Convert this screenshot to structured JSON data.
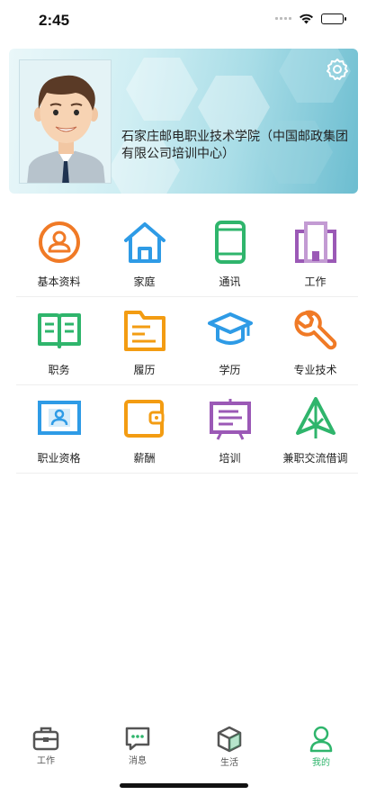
{
  "status_bar": {
    "time": "2:45"
  },
  "profile": {
    "organization": "石家庄邮电职业技术学院（中国邮政集团有限公司培训中心）",
    "accent": "#6cbdd0"
  },
  "grid": [
    {
      "label": "基本资料",
      "icon": "person-circle-icon",
      "color": "#f07a26"
    },
    {
      "label": "家庭",
      "icon": "house-icon",
      "color": "#2e9be6"
    },
    {
      "label": "通讯",
      "icon": "phone-icon",
      "color": "#2fb56c"
    },
    {
      "label": "工作",
      "icon": "building-icon",
      "color": "#9b59b6"
    },
    {
      "label": "职务",
      "icon": "book-icon",
      "color": "#2fb56c"
    },
    {
      "label": "履历",
      "icon": "folder-icon",
      "color": "#f39c12"
    },
    {
      "label": "学历",
      "icon": "graduation-cap-icon",
      "color": "#2e9be6"
    },
    {
      "label": "专业技术",
      "icon": "wrench-icon",
      "color": "#f07a26"
    },
    {
      "label": "职业资格",
      "icon": "id-card-icon",
      "color": "#2e9be6"
    },
    {
      "label": "薪酬",
      "icon": "wallet-icon",
      "color": "#f39c12"
    },
    {
      "label": "培训",
      "icon": "easel-board-icon",
      "color": "#9b59b6"
    },
    {
      "label": "兼职交流借调",
      "icon": "paper-plane-icon",
      "color": "#2fb56c"
    }
  ],
  "tabs": [
    {
      "label": "工作",
      "icon": "briefcase-icon",
      "active": false
    },
    {
      "label": "消息",
      "icon": "chat-bubble-icon",
      "active": false
    },
    {
      "label": "生活",
      "icon": "cube-icon",
      "active": false
    },
    {
      "label": "我的",
      "icon": "person-icon",
      "active": true
    }
  ],
  "colors": {
    "active_tab": "#2fb56c",
    "inactive_tab": "#555555"
  }
}
